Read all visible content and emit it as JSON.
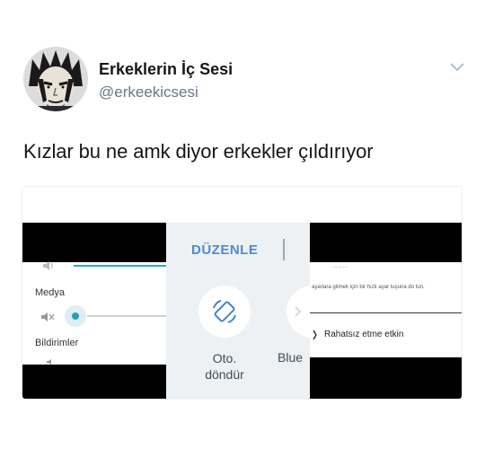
{
  "tweet": {
    "display_name": "Erkeklerin İç Sesi",
    "handle": "@erkeekicsesi",
    "text": "Kızlar bu ne amk diyor erkekler çıldırıyor",
    "icons": {
      "avatar": "avatar-cartoon-face",
      "menu": "chevron-down-icon"
    }
  },
  "media": {
    "left_panel": {
      "media_label": "Medya",
      "notifications_label": "Bildirimler",
      "accent_color": "#33a6c4"
    },
    "middle_panel": {
      "edit_label": "DÜZENLE",
      "auto_rotate_label": "Oto.\ndöndür",
      "bluetooth_label": "Blue",
      "accent_color": "#4a8ccf"
    },
    "right_panel": {
      "top_fragment": "...  ... ...",
      "info_text": "ayarlara gitmek için bir hızlı ayar tuşuna do tun.",
      "dnd_label": "Rahatsız etme etkin"
    }
  }
}
